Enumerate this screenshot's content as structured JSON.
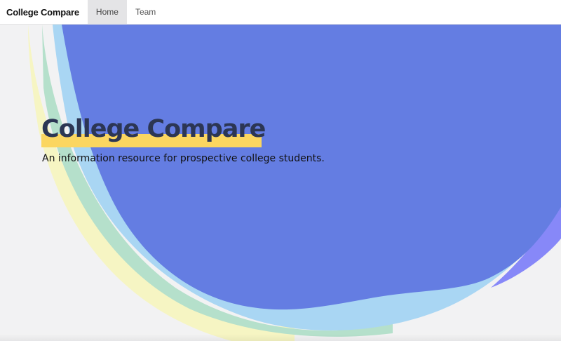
{
  "navbar": {
    "brand": "College Compare",
    "links": [
      {
        "label": "Home",
        "active": true
      },
      {
        "label": "Team",
        "active": false
      }
    ]
  },
  "hero": {
    "title": "College Compare",
    "subtitle": "An information resource for prospective college students."
  },
  "colors": {
    "blob_main": "#647de2",
    "blob_light_blue": "#a9d6f3",
    "blob_green": "#b5e0cb",
    "blob_yellow": "#f6f5c3",
    "blob_violet": "#8788f8",
    "highlight": "#fbd660",
    "title_text": "#2c3654"
  }
}
